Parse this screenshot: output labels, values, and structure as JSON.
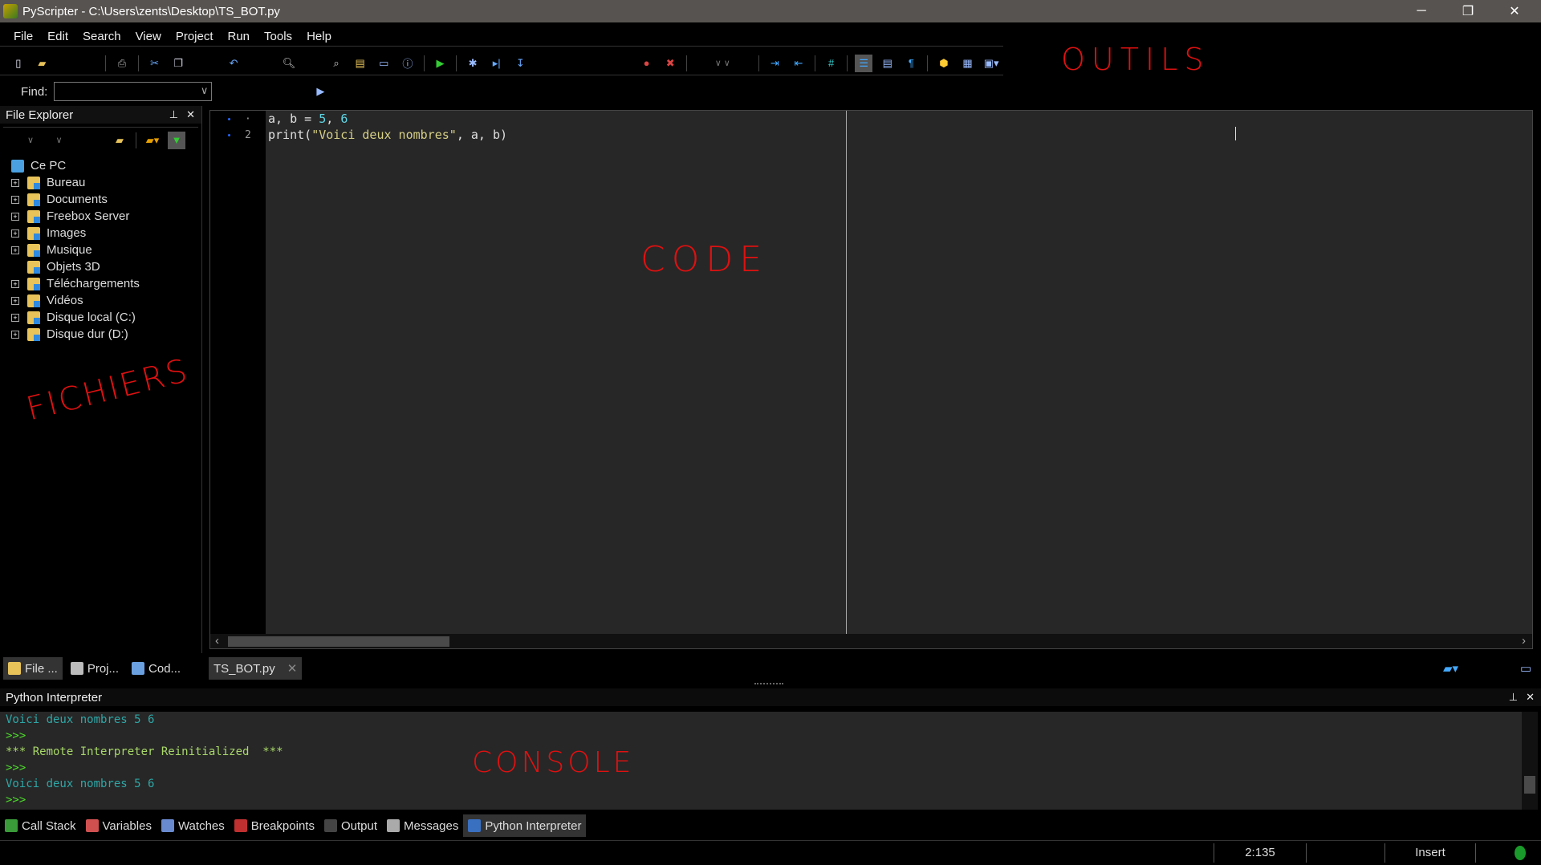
{
  "window": {
    "title": "PyScripter - C:\\Users\\zents\\Desktop\\TS_BOT.py",
    "minimize": "─",
    "restore": "❐",
    "close": "✕"
  },
  "menu": [
    "File",
    "Edit",
    "Search",
    "View",
    "Project",
    "Run",
    "Tools",
    "Help"
  ],
  "find": {
    "label": "Find:",
    "value": "",
    "dropdown": "∨"
  },
  "file_explorer": {
    "title": "File Explorer",
    "pin": "⊥",
    "close": "✕",
    "root": "Ce PC",
    "items": [
      {
        "label": "Bureau",
        "expand": "+"
      },
      {
        "label": "Documents",
        "expand": "+"
      },
      {
        "label": "Freebox Server",
        "expand": "+"
      },
      {
        "label": "Images",
        "expand": "+"
      },
      {
        "label": "Musique",
        "expand": "+"
      },
      {
        "label": "Objets 3D",
        "expand": ""
      },
      {
        "label": "Téléchargements",
        "expand": "+"
      },
      {
        "label": "Vidéos",
        "expand": "+"
      },
      {
        "label": "Disque local (C:)",
        "expand": "+"
      },
      {
        "label": "Disque dur (D:)",
        "expand": "+"
      }
    ]
  },
  "editor": {
    "lines": [
      {
        "number": "·",
        "tokens": [
          [
            "id",
            "a, b = "
          ],
          [
            "num",
            "5"
          ],
          [
            "id",
            ", "
          ],
          [
            "num",
            "6"
          ]
        ]
      },
      {
        "number": "2",
        "tokens": [
          [
            "id",
            "print("
          ],
          [
            "str",
            "\"Voici deux nombres\""
          ],
          [
            "id",
            ", a, b)"
          ]
        ]
      }
    ],
    "scroll_left": "‹",
    "scroll_right": "›"
  },
  "side_tabs": [
    {
      "label": "File ...",
      "color": "#e8c35a"
    },
    {
      "label": "Proj...",
      "color": "#bbb"
    },
    {
      "label": "Cod...",
      "color": "#6aa0e0"
    }
  ],
  "editor_tabs": [
    {
      "label": "TS_BOT.py",
      "close": "✕"
    }
  ],
  "interpreter": {
    "title": "Python Interpreter",
    "pin": "⊥",
    "close": "✕",
    "lines": [
      {
        "cls": "teal",
        "text": "Voici deux nombres 5 6"
      },
      {
        "cls": "green",
        "text": ">>>"
      },
      {
        "cls": "lime",
        "text": "*** Remote Interpreter Reinitialized  ***"
      },
      {
        "cls": "green",
        "text": ">>>"
      },
      {
        "cls": "teal",
        "text": "Voici deux nombres 5 6"
      },
      {
        "cls": "green",
        "text": ">>>"
      }
    ]
  },
  "bottom_tabs": [
    {
      "label": "Call Stack",
      "color": "#3a9a3a"
    },
    {
      "label": "Variables",
      "color": "#d05050"
    },
    {
      "label": "Watches",
      "color": "#6a8ad0"
    },
    {
      "label": "Breakpoints",
      "color": "#c03030"
    },
    {
      "label": "Output",
      "color": "#444"
    },
    {
      "label": "Messages",
      "color": "#aaa"
    },
    {
      "label": "Python Interpreter",
      "color": "#3a70c0",
      "active": true
    }
  ],
  "status": {
    "position": "2:135",
    "mode": "Insert"
  },
  "annotations": {
    "tools": "OUTILS",
    "code": "CODE",
    "files": "FICHIERS",
    "console": "CONSOLE"
  },
  "colors": {
    "annotation": "#e01010",
    "accent": "#2e8ae0"
  }
}
